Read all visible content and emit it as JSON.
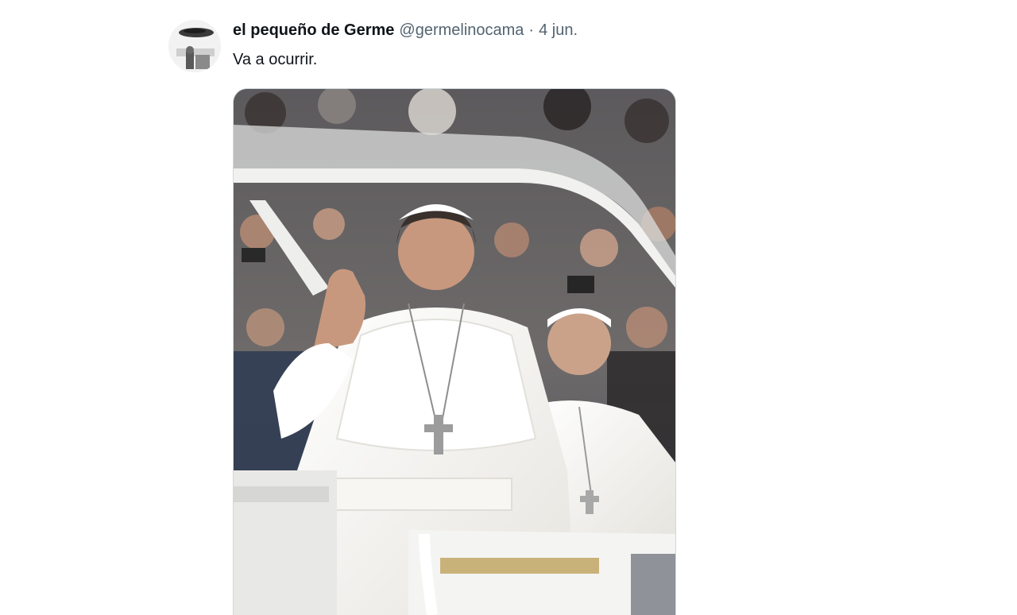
{
  "tweet": {
    "display_name": "el pequeño de Germe",
    "handle": "@germelinocama",
    "separator": "·",
    "timestamp": "4 jun.",
    "text": "Va a ocurrir."
  },
  "icons": {
    "avatar": "user-avatar-photo",
    "media": "tweet-photo"
  },
  "colors": {
    "primary_text": "#0f1419",
    "secondary_text": "#536471",
    "media_border": "#cfd9de"
  }
}
